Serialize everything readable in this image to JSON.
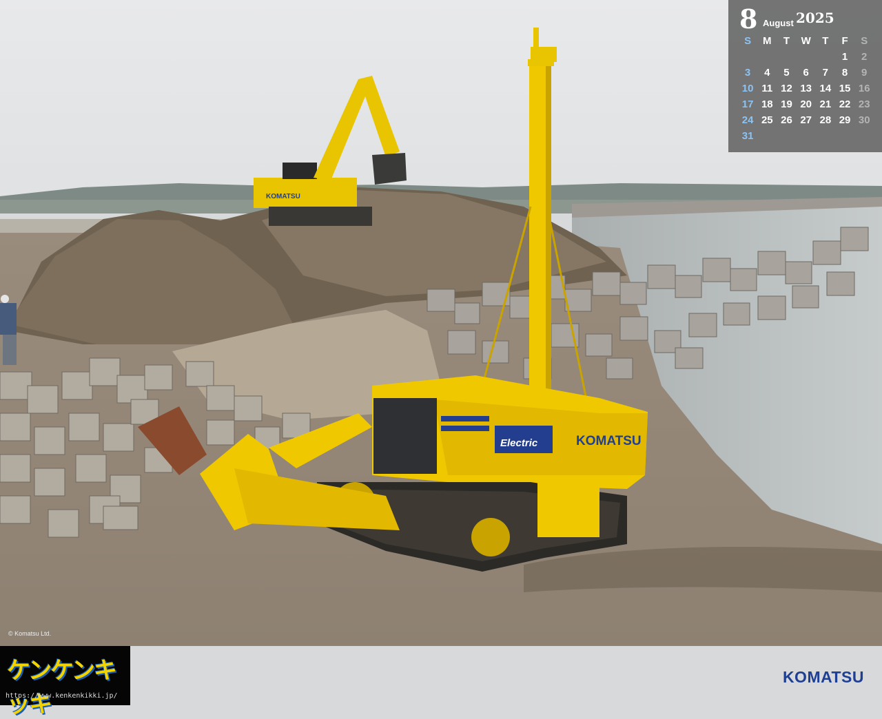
{
  "calendar": {
    "month_number": "8",
    "month_name": "August",
    "year": "2025",
    "weekdays": [
      "S",
      "M",
      "T",
      "W",
      "T",
      "F",
      "S"
    ],
    "days": [
      "",
      "",
      "",
      "",
      "",
      "1",
      "2",
      "3",
      "4",
      "5",
      "6",
      "7",
      "8",
      "9",
      "10",
      "11",
      "12",
      "13",
      "14",
      "15",
      "16",
      "17",
      "18",
      "19",
      "20",
      "21",
      "22",
      "23",
      "24",
      "25",
      "26",
      "27",
      "28",
      "29",
      "30",
      "31",
      "",
      "",
      "",
      "",
      "",
      ""
    ],
    "sunday_color": "#8cc3f2",
    "saturday_color": "#b4b4b4"
  },
  "photo": {
    "machine_brand": "KOMATSU",
    "machine_badge": "Electric",
    "excavator_brand": "KOMATSU",
    "copyright": "© Komatsu Ltd."
  },
  "footer": {
    "logo_text": "ケンケンキッキ",
    "logo_url": "https://www.kenkenkikki.jp/",
    "brand": "KOMATSU",
    "brand_color": "#1f3f93"
  }
}
